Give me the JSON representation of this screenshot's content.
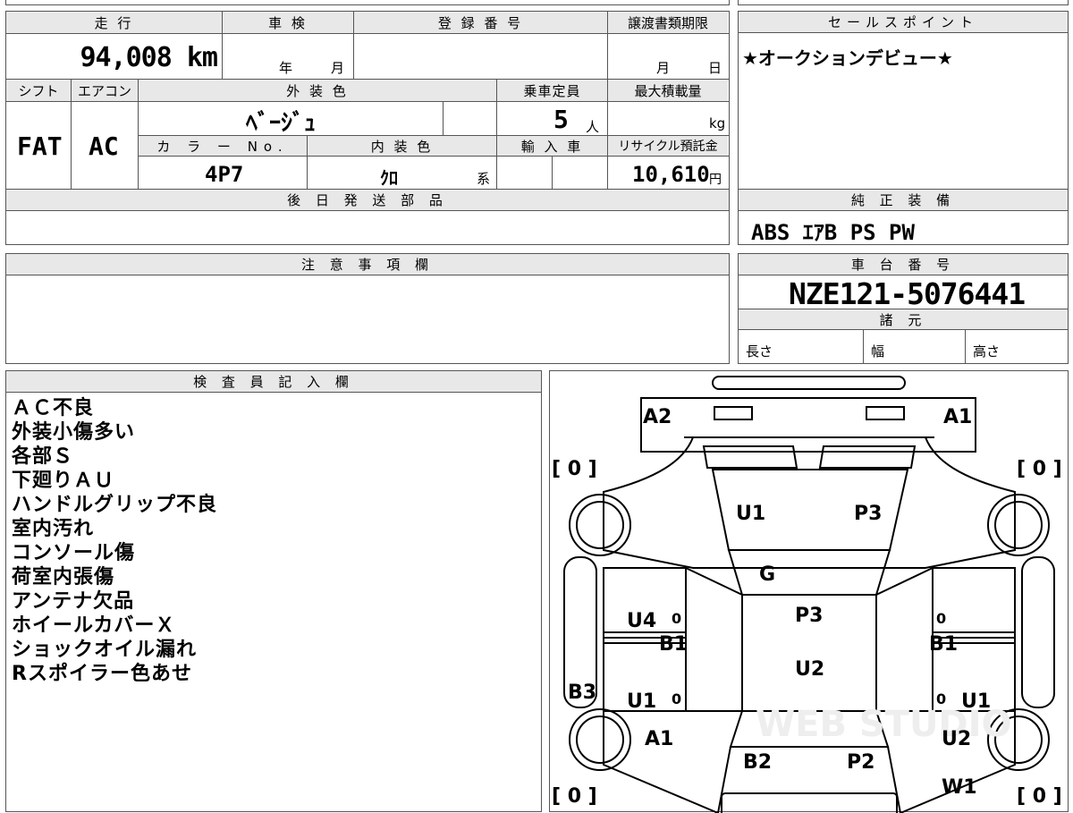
{
  "spec": {
    "mileage_label": "走 行",
    "mileage_value": "94,008 km",
    "inspection_label": "車 検",
    "inspection_year": "年",
    "inspection_month": "月",
    "registration_label": "登 録 番 号",
    "transfer_deadline_label": "譲渡書類期限",
    "transfer_month": "月",
    "transfer_day": "日",
    "shift_label": "シフト",
    "shift_value": "FAT",
    "ac_label": "エアコン",
    "ac_value": "AC",
    "exterior_color_label": "外 装 色",
    "exterior_color_value": "ﾍﾞｰｼﾞｭ",
    "capacity_label": "乗車定員",
    "capacity_value": "5",
    "capacity_unit": "人",
    "max_load_label": "最大積載量",
    "max_load_unit": "kg",
    "color_no_label": "カ ラ ー No.",
    "color_no_value": "4P7",
    "interior_color_label": "内 装 色",
    "interior_color_value": "ｸﾛ",
    "interior_color_suffix": "系",
    "import_label": "輸 入 車",
    "recycle_label": "リサイクル預託金",
    "recycle_value": "10,610",
    "recycle_unit": "円",
    "later_parts_label": "後 日 発 送 部 品"
  },
  "sales_point": {
    "label": "セールスポイント",
    "text": "★オークションデビュー★"
  },
  "equipment": {
    "label": "純 正 装 備",
    "text": "ABS ｴｱB PS PW"
  },
  "caution": {
    "label": "注 意 事 項 欄"
  },
  "chassis": {
    "label": "車 台 番 号",
    "value": "NZE121-5076441",
    "dims_label": "諸 元",
    "length_label": "長さ",
    "width_label": "幅",
    "height_label": "高さ"
  },
  "inspector": {
    "label": "検 査 員 記 入 欄",
    "notes": [
      "ＡＣ不良",
      "外装小傷多い",
      "各部Ｓ",
      "下廻りＡＵ",
      "ハンドルグリップ不良",
      "室内汚れ",
      "コンソール傷",
      "荷室内張傷",
      "アンテナ欠品",
      "ホイールカバーＸ",
      "ショックオイル漏れ",
      "Rスポイラー色あせ"
    ]
  },
  "diagram": {
    "tires": [
      "[ 0 ]",
      "[ 0 ]",
      "[ 0 ]",
      "[ 0 ]"
    ],
    "marks": {
      "front_left": "A2",
      "front_right": "A1",
      "hood_left": "U1",
      "hood_right": "P3",
      "windshield": "G",
      "roof_top": "P3",
      "roof_bottom": "U2",
      "left_front_door": "U4",
      "left_front_door_b": "B1",
      "right_front_door_b": "B1",
      "left_rear_door": "U1",
      "right_rear_door": "U1",
      "left_sill": "B3",
      "left_rear_fender": "A1",
      "right_rear_fender": "U2",
      "trunk_left": "B2",
      "trunk_right": "P2",
      "right_rear_wheel": "W1",
      "door_zero_1": "0",
      "door_zero_2": "0",
      "door_zero_3": "0",
      "door_zero_4": "0"
    },
    "watermark": "WEB STUDIO"
  }
}
